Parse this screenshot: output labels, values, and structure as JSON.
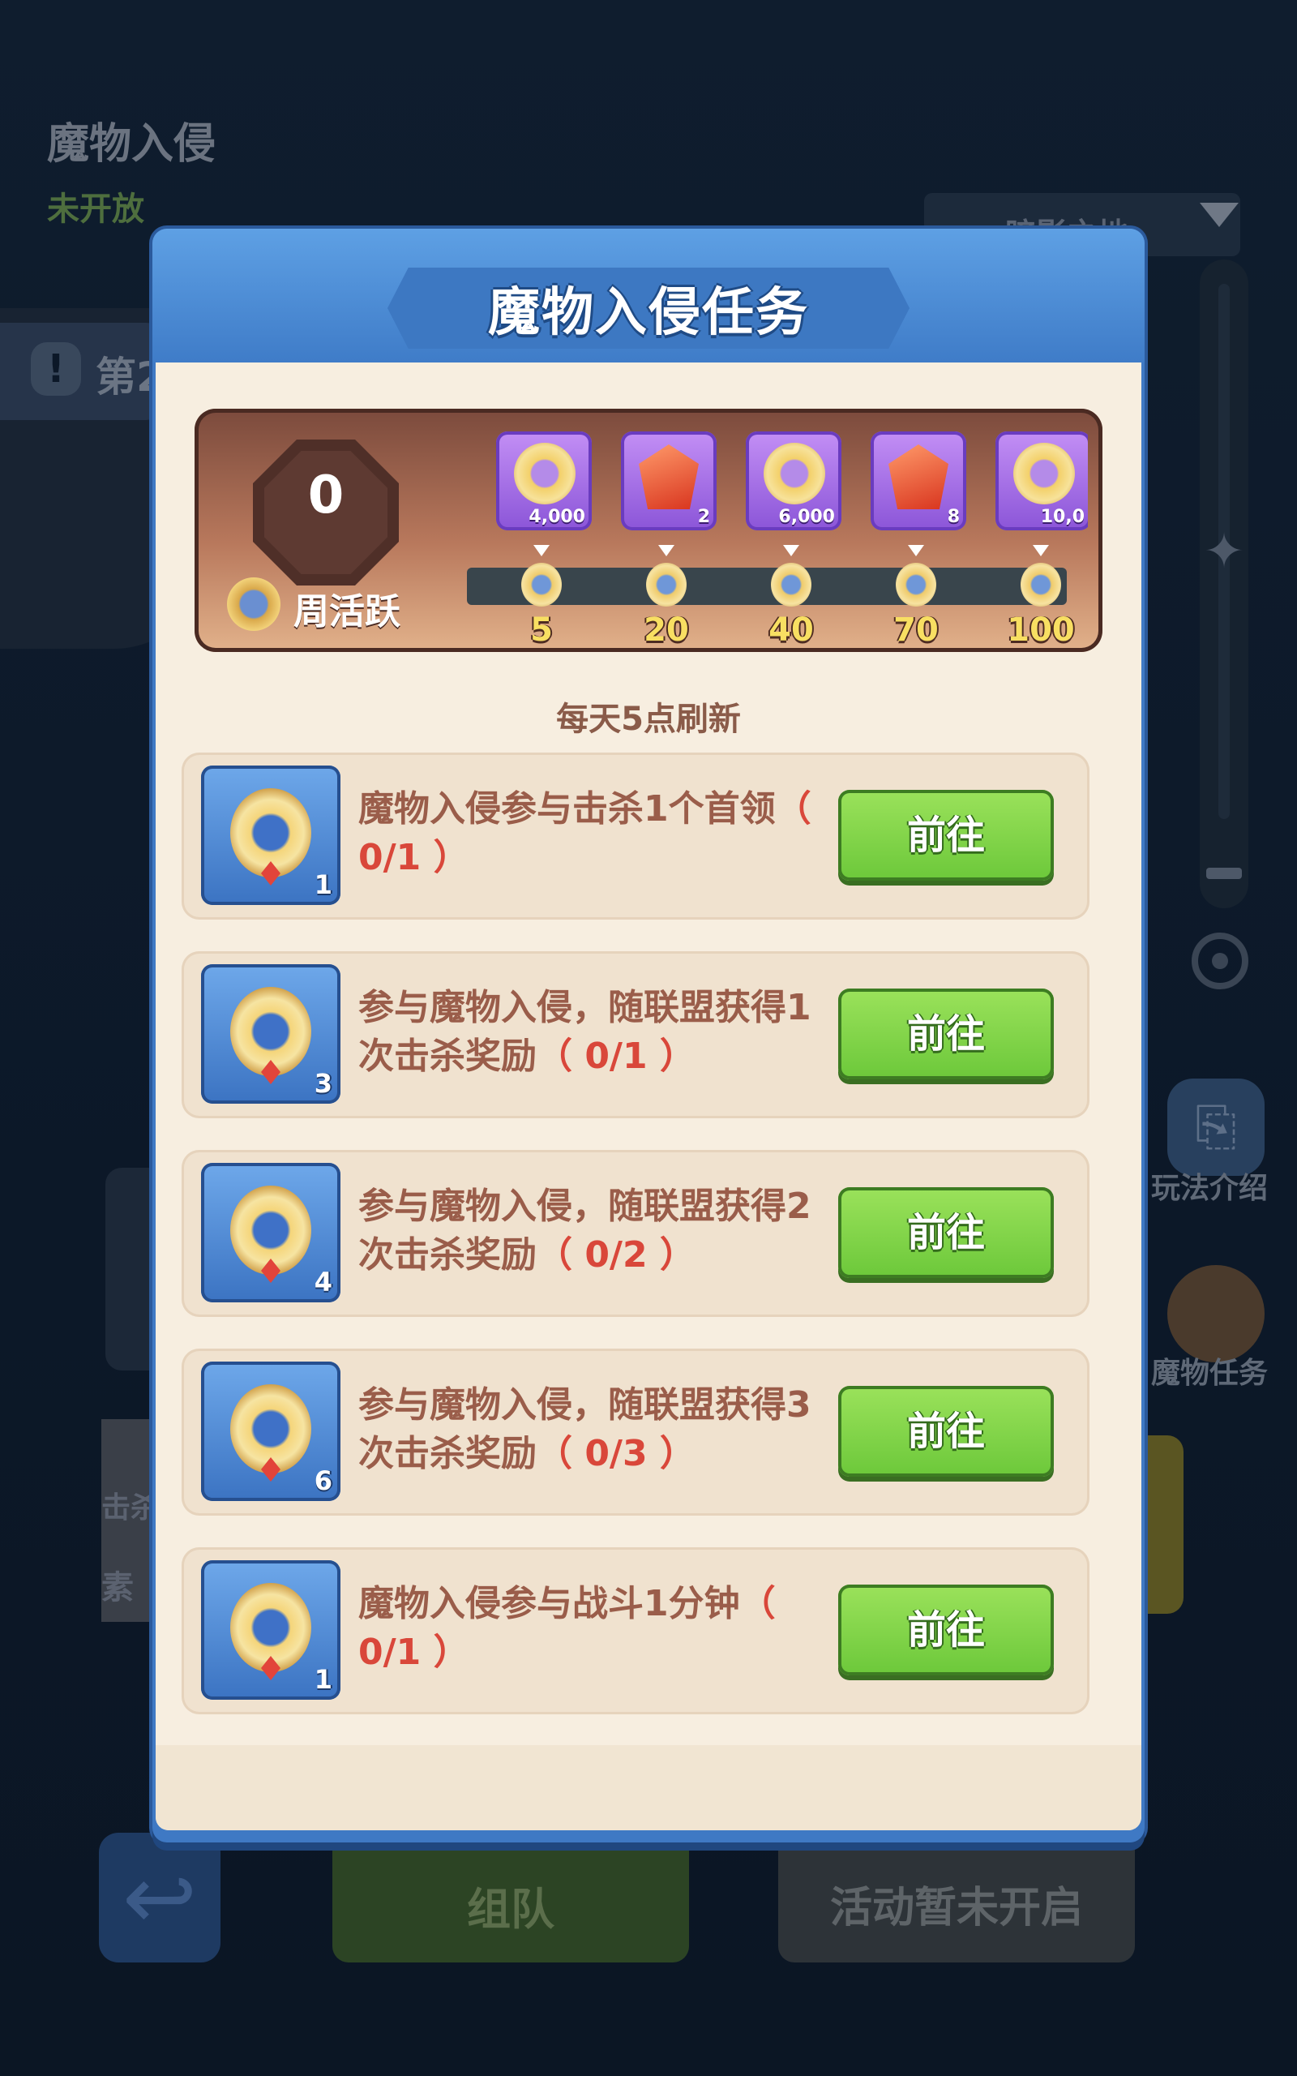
{
  "background": {
    "event_title": "魔物入侵",
    "event_status": "未开放",
    "warn_text": "第2",
    "dropdown_label": "暗影之地",
    "rules_label": "玩法介绍",
    "monster_task_label": "魔物任务",
    "left_text_1": "击杀",
    "left_text_2": "素",
    "team_button": "组队",
    "closed_button": "活动暂未开启"
  },
  "modal": {
    "title": "魔物入侵任务",
    "activity": {
      "value": "0",
      "label": "周活跃",
      "rewards": [
        {
          "type": "coin",
          "qty": "4,000"
        },
        {
          "type": "gem",
          "qty": "2"
        },
        {
          "type": "coin",
          "qty": "6,000"
        },
        {
          "type": "gem",
          "qty": "8"
        },
        {
          "type": "coin",
          "qty": "10,0"
        }
      ],
      "milestones": [
        "5",
        "20",
        "40",
        "70",
        "100"
      ]
    },
    "refresh_note": "每天5点刷新",
    "tasks": [
      {
        "text": "魔物入侵参与击杀1个首领",
        "progress": "（ 0/1 ）",
        "count": "1",
        "button": "前往"
      },
      {
        "text": "参与魔物入侵，随联盟获得1次击杀奖励",
        "progress": "（ 0/1 ）",
        "count": "3",
        "button": "前往"
      },
      {
        "text": "参与魔物入侵，随联盟获得2次击杀奖励",
        "progress": "（ 0/2 ）",
        "count": "4",
        "button": "前往"
      },
      {
        "text": "参与魔物入侵，随联盟获得3次击杀奖励",
        "progress": "（ 0/3 ）",
        "count": "6",
        "button": "前往"
      },
      {
        "text": "魔物入侵参与战斗1分钟",
        "progress": "（ 0/1 ）",
        "count": "1",
        "button": "前往"
      }
    ]
  }
}
